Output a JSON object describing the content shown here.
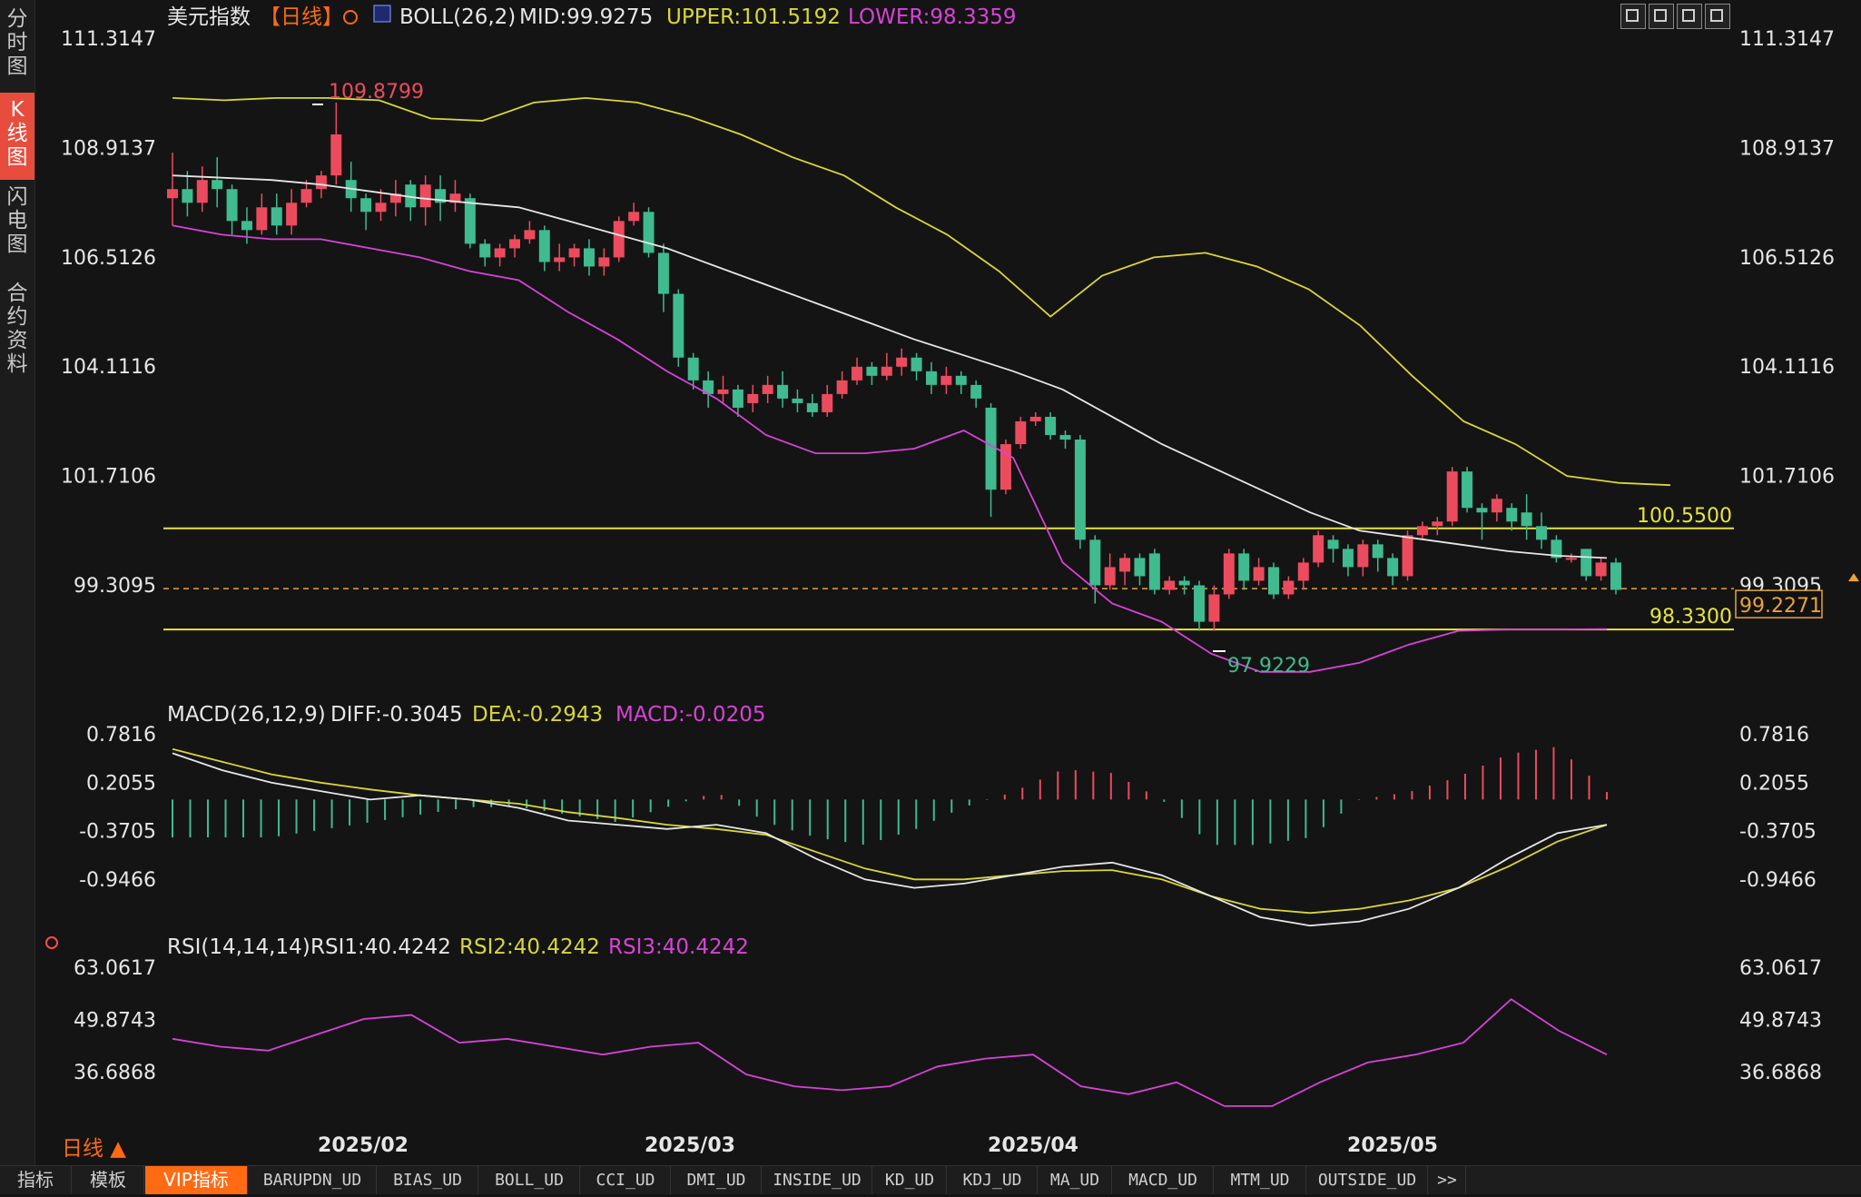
{
  "window": {
    "title": "美元指数",
    "period_label": "【日线】"
  },
  "sidebar": {
    "items": [
      {
        "label": "分时图",
        "active": false
      },
      {
        "label": "K线图",
        "active": true
      },
      {
        "label": "闪电图",
        "active": false
      },
      {
        "label": "合约资料",
        "active": false
      }
    ]
  },
  "toolbar": {
    "icons": [
      "grid-icon",
      "layout-icon",
      "layout-next-icon",
      "tile-icon"
    ]
  },
  "main_chart": {
    "indicator": "BOLL(26,2)",
    "mid_label": "MID:99.9275",
    "upper_label": "UPPER:101.5192",
    "lower_label": "LOWER:98.3359",
    "ticks": [
      "111.3147",
      "108.9137",
      "106.5126",
      "104.1116",
      "101.7106",
      "99.3095"
    ],
    "current_price": "99.2271",
    "high_label": "109.8799",
    "low_label": "97.9229",
    "levels": [
      {
        "label": "100.5500",
        "value": 100.55
      },
      {
        "label": "98.3300",
        "value": 98.33
      }
    ],
    "colors": {
      "up": "#ec4b5e",
      "down": "#3fbb8f",
      "mid": "#e6e6e6",
      "upper": "#d8d63a",
      "lower": "#d743d7"
    }
  },
  "macd": {
    "title": "MACD(26,12,9)",
    "diff_label": "DIFF:-0.3045",
    "dea_label": "DEA:-0.2943",
    "macd_label": "MACD:-0.0205",
    "ticks": [
      "0.7816",
      "0.2055",
      "-0.3705",
      "-0.9466"
    ]
  },
  "rsi": {
    "title": "RSI(14,14,14)",
    "rsi1_label": "RSI1:40.4242",
    "rsi2_label": "RSI2:40.4242",
    "rsi3_label": "RSI3:40.4242",
    "ticks": [
      "63.0617",
      "49.8743",
      "36.6868"
    ]
  },
  "x_axis": {
    "labels": [
      "2025/02",
      "2025/03",
      "2025/04",
      "2025/05"
    ]
  },
  "footer": {
    "period": "日线 ▲"
  },
  "bottom_tabs": [
    "指标",
    "模板",
    "VIP指标",
    "BARUPDN_UD",
    "BIAS_UD",
    "BOLL_UD",
    "CCI_UD",
    "DMI_UD",
    "INSIDE_UD",
    "KD_UD",
    "KDJ_UD",
    "MA_UD",
    "MACD_UD",
    "MTM_UD",
    "OUTSIDE_UD",
    ">>"
  ],
  "chart_data": {
    "type": "candlestick",
    "price_y": [
      111.3147,
      108.9137,
      106.5126,
      104.1116,
      101.7106,
      99.3095
    ],
    "candles": [
      [
        107.8,
        108.0,
        107.2,
        108.8
      ],
      [
        108.0,
        107.7,
        107.4,
        108.4
      ],
      [
        107.7,
        108.2,
        107.5,
        108.5
      ],
      [
        108.2,
        108.0,
        107.6,
        108.7
      ],
      [
        108.0,
        107.3,
        107.0,
        108.1
      ],
      [
        107.3,
        107.1,
        106.8,
        107.6
      ],
      [
        107.1,
        107.6,
        107.0,
        107.9
      ],
      [
        107.6,
        107.2,
        107.0,
        107.9
      ],
      [
        107.2,
        107.7,
        107.0,
        108.0
      ],
      [
        107.7,
        108.0,
        107.6,
        108.2
      ],
      [
        108.0,
        108.3,
        107.8,
        108.4
      ],
      [
        108.3,
        109.2,
        108.1,
        109.9
      ],
      [
        108.2,
        107.8,
        107.5,
        108.6
      ],
      [
        107.8,
        107.5,
        107.1,
        107.9
      ],
      [
        107.5,
        107.7,
        107.3,
        108.0
      ],
      [
        107.7,
        107.9,
        107.4,
        108.2
      ],
      [
        108.1,
        107.6,
        107.3,
        108.2
      ],
      [
        107.6,
        108.1,
        107.2,
        108.3
      ],
      [
        108.0,
        107.7,
        107.3,
        108.3
      ],
      [
        107.7,
        107.9,
        107.5,
        108.2
      ],
      [
        107.8,
        106.8,
        106.7,
        107.9
      ],
      [
        106.8,
        106.5,
        106.3,
        106.9
      ],
      [
        106.5,
        106.7,
        106.3,
        106.8
      ],
      [
        106.7,
        106.9,
        106.5,
        107.0
      ],
      [
        106.9,
        107.1,
        106.8,
        107.3
      ],
      [
        107.1,
        106.4,
        106.2,
        107.2
      ],
      [
        106.4,
        106.5,
        106.2,
        106.8
      ],
      [
        106.5,
        106.7,
        106.3,
        106.8
      ],
      [
        106.7,
        106.3,
        106.1,
        106.9
      ],
      [
        106.3,
        106.5,
        106.1,
        106.7
      ],
      [
        106.5,
        107.3,
        106.4,
        107.4
      ],
      [
        107.3,
        107.5,
        107.2,
        107.7
      ],
      [
        107.5,
        106.6,
        106.5,
        107.6
      ],
      [
        106.6,
        105.7,
        105.3,
        106.8
      ],
      [
        105.7,
        104.3,
        104.1,
        105.8
      ],
      [
        104.3,
        103.8,
        103.6,
        104.4
      ],
      [
        103.8,
        103.5,
        103.2,
        104.0
      ],
      [
        103.5,
        103.6,
        103.3,
        103.9
      ],
      [
        103.6,
        103.2,
        103.0,
        103.7
      ],
      [
        103.3,
        103.5,
        103.1,
        103.7
      ],
      [
        103.5,
        103.7,
        103.3,
        103.9
      ],
      [
        103.7,
        103.4,
        103.2,
        104.0
      ],
      [
        103.4,
        103.3,
        103.1,
        103.6
      ],
      [
        103.3,
        103.1,
        103.0,
        103.5
      ],
      [
        103.1,
        103.5,
        103.0,
        103.7
      ],
      [
        103.5,
        103.8,
        103.4,
        104.0
      ],
      [
        103.8,
        104.1,
        103.7,
        104.3
      ],
      [
        104.1,
        103.9,
        103.7,
        104.2
      ],
      [
        103.9,
        104.1,
        103.8,
        104.4
      ],
      [
        104.1,
        104.3,
        103.9,
        104.5
      ],
      [
        104.3,
        104.0,
        103.8,
        104.4
      ],
      [
        104.0,
        103.7,
        103.5,
        104.2
      ],
      [
        103.7,
        103.9,
        103.5,
        104.1
      ],
      [
        103.9,
        103.7,
        103.5,
        104.0
      ],
      [
        103.7,
        103.4,
        103.2,
        103.8
      ],
      [
        103.2,
        101.4,
        100.8,
        103.3
      ],
      [
        101.4,
        102.4,
        101.3,
        102.5
      ],
      [
        102.4,
        102.9,
        102.3,
        103.0
      ],
      [
        102.9,
        103.0,
        102.8,
        103.1
      ],
      [
        103.0,
        102.6,
        102.5,
        103.1
      ],
      [
        102.6,
        102.5,
        102.3,
        102.7
      ],
      [
        102.5,
        100.3,
        100.1,
        102.6
      ],
      [
        100.3,
        99.3,
        98.9,
        100.4
      ],
      [
        99.3,
        99.7,
        99.2,
        100.0
      ],
      [
        99.6,
        99.9,
        99.3,
        100.0
      ],
      [
        99.9,
        99.5,
        99.3,
        100.0
      ],
      [
        100.0,
        99.2,
        99.1,
        100.1
      ],
      [
        99.2,
        99.4,
        99.1,
        99.5
      ],
      [
        99.4,
        99.3,
        99.1,
        99.5
      ],
      [
        99.3,
        98.5,
        98.3,
        99.4
      ],
      [
        98.5,
        99.1,
        98.3,
        99.3
      ],
      [
        99.1,
        100.0,
        99.0,
        100.1
      ],
      [
        100.0,
        99.4,
        99.2,
        100.1
      ],
      [
        99.4,
        99.7,
        99.3,
        99.9
      ],
      [
        99.7,
        99.1,
        99.0,
        99.8
      ],
      [
        99.1,
        99.4,
        99.0,
        99.5
      ],
      [
        99.4,
        99.8,
        99.2,
        99.9
      ],
      [
        99.8,
        100.4,
        99.7,
        100.5
      ],
      [
        100.3,
        100.1,
        99.8,
        100.4
      ],
      [
        100.1,
        99.7,
        99.5,
        100.2
      ],
      [
        99.7,
        100.2,
        99.5,
        100.3
      ],
      [
        100.2,
        99.9,
        99.6,
        100.3
      ],
      [
        99.9,
        99.5,
        99.3,
        100.0
      ],
      [
        99.5,
        100.4,
        99.4,
        100.5
      ],
      [
        100.4,
        100.6,
        100.3,
        100.7
      ],
      [
        100.6,
        100.7,
        100.4,
        100.8
      ],
      [
        100.7,
        101.8,
        100.6,
        101.9
      ],
      [
        101.8,
        101.0,
        100.9,
        101.9
      ],
      [
        101.0,
        100.9,
        100.3,
        101.1
      ],
      [
        100.9,
        101.2,
        100.7,
        101.3
      ],
      [
        101.0,
        100.7,
        100.5,
        101.1
      ],
      [
        100.9,
        100.6,
        100.3,
        101.3
      ],
      [
        100.6,
        100.3,
        100.1,
        100.9
      ],
      [
        100.3,
        99.9,
        99.8,
        100.4
      ],
      [
        99.9,
        99.9,
        99.8,
        100.0
      ],
      [
        100.1,
        99.5,
        99.4,
        100.1
      ],
      [
        99.5,
        99.8,
        99.4,
        99.9
      ],
      [
        99.8,
        99.2,
        99.1,
        99.9
      ]
    ],
    "mid": [
      108.3,
      108.25,
      108.2,
      108.1,
      107.95,
      107.8,
      107.7,
      107.6,
      107.3,
      107.0,
      106.7,
      106.3,
      105.9,
      105.5,
      105.1,
      104.7,
      104.35,
      104.0,
      103.6,
      103.0,
      102.4,
      101.9,
      101.4,
      100.9,
      100.5,
      100.35,
      100.2,
      100.05,
      99.95,
      99.9
    ],
    "upper": [
      110.0,
      109.95,
      110.0,
      110.0,
      109.95,
      109.55,
      109.5,
      109.9,
      110.0,
      109.9,
      109.6,
      109.2,
      108.7,
      108.3,
      107.6,
      107.0,
      106.2,
      105.2,
      106.1,
      106.5,
      106.6,
      106.3,
      105.8,
      105.0,
      103.9,
      102.9,
      102.4,
      101.7,
      101.55,
      101.5
    ],
    "lower": [
      107.2,
      107.0,
      106.9,
      106.9,
      106.7,
      106.5,
      106.2,
      106.0,
      105.3,
      104.7,
      104.0,
      103.4,
      102.6,
      102.2,
      102.2,
      102.3,
      102.7,
      102.1,
      99.8,
      98.9,
      98.5,
      97.8,
      97.4,
      97.4,
      97.6,
      98.0,
      98.3,
      98.33,
      98.33,
      98.34
    ],
    "macd": {
      "diff": [
        0.55,
        0.35,
        0.2,
        0.1,
        0.0,
        0.05,
        0.0,
        -0.1,
        -0.25,
        -0.3,
        -0.35,
        -0.3,
        -0.4,
        -0.7,
        -0.95,
        -1.05,
        -1.0,
        -0.9,
        -0.8,
        -0.75,
        -0.9,
        -1.15,
        -1.4,
        -1.5,
        -1.45,
        -1.3,
        -1.05,
        -0.7,
        -0.4,
        -0.3
      ],
      "dea": [
        0.6,
        0.45,
        0.3,
        0.2,
        0.12,
        0.05,
        0.0,
        -0.05,
        -0.15,
        -0.22,
        -0.3,
        -0.35,
        -0.42,
        -0.62,
        -0.82,
        -0.95,
        -0.95,
        -0.9,
        -0.85,
        -0.84,
        -0.95,
        -1.15,
        -1.3,
        -1.35,
        -1.3,
        -1.2,
        -1.05,
        -0.8,
        -0.5,
        -0.3
      ],
      "hist": [
        -0.5,
        -0.5,
        -0.5,
        -0.4,
        -0.3,
        -0.2,
        -0.1,
        -0.1,
        -0.2,
        -0.3,
        -0.1,
        0.1,
        -0.3,
        -0.5,
        -0.6,
        -0.4,
        -0.1,
        0.1,
        0.4,
        0.35,
        0.0,
        -0.6,
        -0.6,
        -0.5,
        0.0,
        0.1,
        0.3,
        0.6,
        0.7,
        0.1
      ]
    },
    "rsi": [
      45,
      43,
      42,
      46,
      50,
      51,
      44,
      45,
      43,
      41,
      43,
      44,
      36,
      33,
      32,
      33,
      38,
      40,
      41,
      33,
      31,
      34,
      28,
      28,
      34,
      39,
      41,
      44,
      55,
      47,
      41
    ]
  }
}
